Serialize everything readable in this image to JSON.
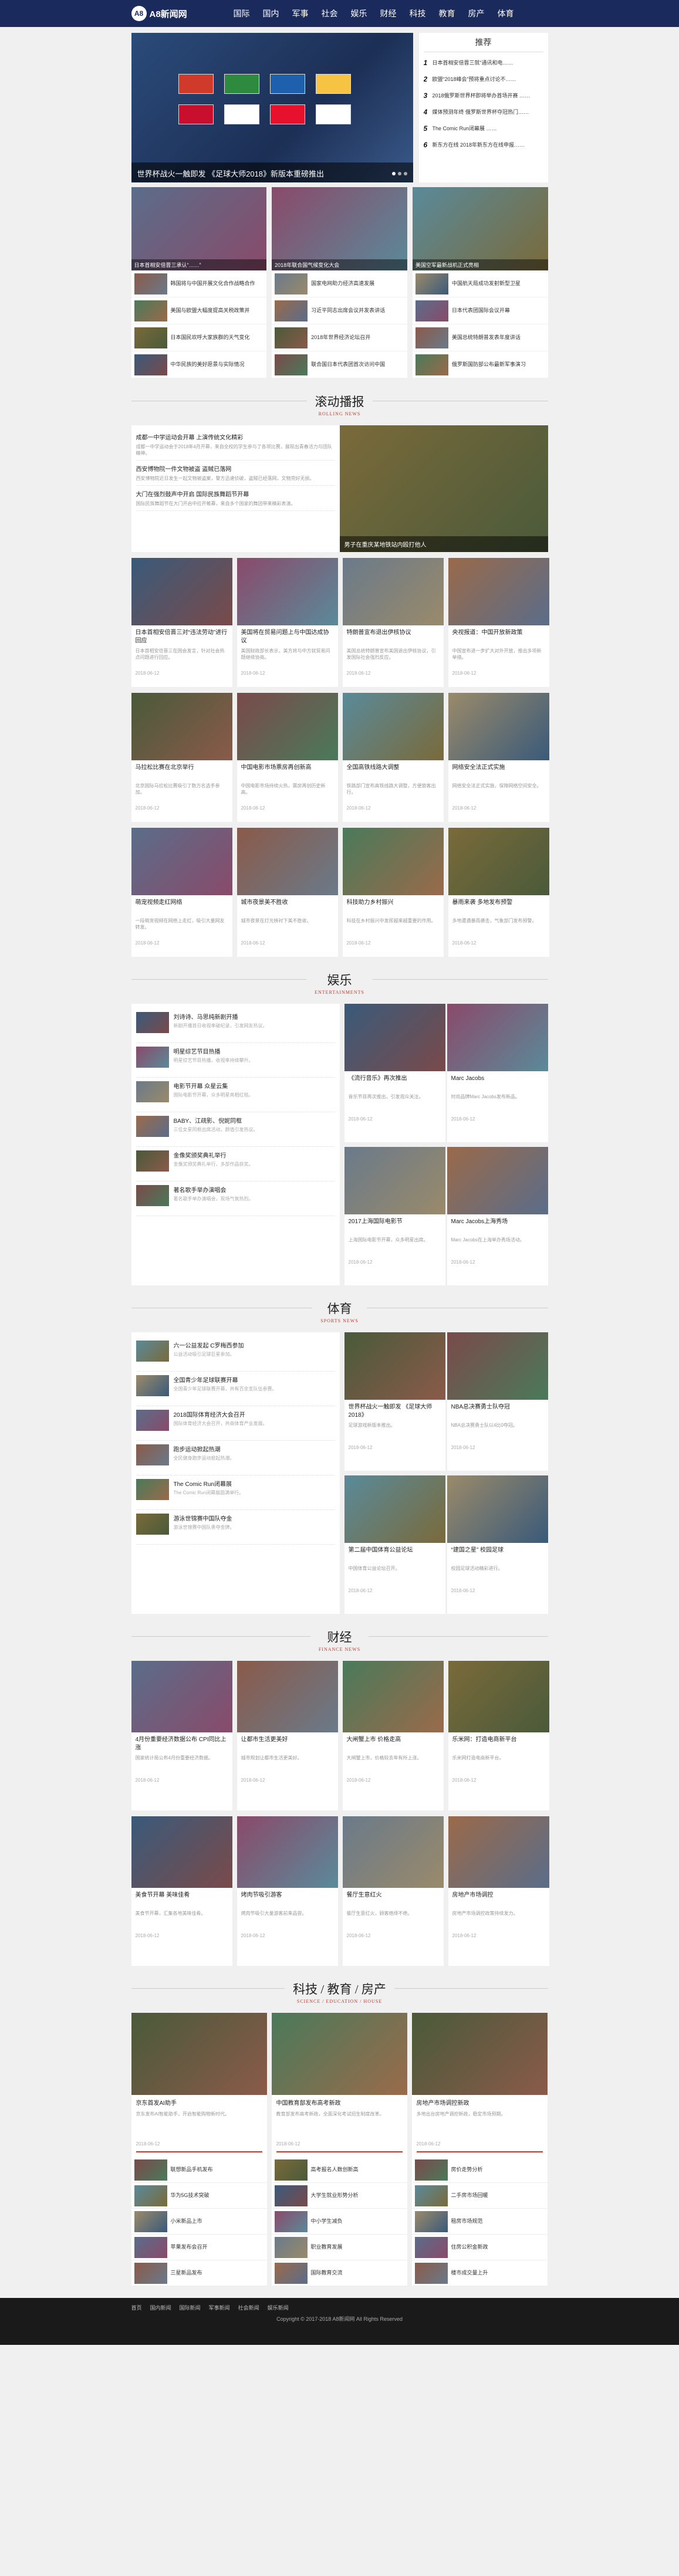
{
  "header": {
    "logo": "A8新闻网",
    "logo_mark": "A8",
    "nav": [
      "国际",
      "国内",
      "军事",
      "社会",
      "娱乐",
      "财经",
      "科技",
      "教育",
      "房产",
      "体育"
    ]
  },
  "hero": {
    "caption": "世界杯战火一触即发 《足球大师2018》新版本重磅推出",
    "colors": [
      "#d03a2b",
      "#2d8a3e",
      "#1e5fae",
      "#f6c343",
      "#c8102e",
      "#ffffff",
      "#e8112d",
      "#ffffff"
    ]
  },
  "recommend": {
    "title": "推荐",
    "items": [
      "日本首相安倍晋三就“通讯和电……",
      "欧盟“2018峰会”预将重点讨论不……",
      "2018俄罗斯世界杯即将举办首场开赛 ……",
      "媒体预测年终 俄罗斯世界杯夺冠热门……",
      "The Comic Run闭幕展 ……",
      "新东方在线 2018年新东方在线申报……"
    ]
  },
  "top_cols": [
    {
      "caption": "日本首相安倍晋三承认“……”",
      "items": [
        "韩国将与中国开展文化合作战略合作",
        "美国与欧盟大幅度提高关税政策并",
        "日本国民欢呼大家族群的天气变化",
        "中华民族的美好愿景与实际情况"
      ]
    },
    {
      "caption": "2018年联合国气候变化大会",
      "items": [
        "国家电网助力经济高速发展",
        "习近平同志出席会议并发表讲话",
        "2018年世界经济论坛召开",
        "联合国日本代表团首次访问中国"
      ]
    },
    {
      "caption": "美国空军最新战机正式亮相",
      "items": [
        "中国航天局成功发射新型卫星",
        "日本代表团国际会议开幕",
        "美国总统特朗普发表年度讲话",
        "俄罗斯国防部公布最新军事演习"
      ]
    }
  ],
  "section_rolling": {
    "title": "滚动播报",
    "sub": "ROLLING NEWS"
  },
  "rolling": {
    "items": [
      {
        "title": "成都一中学运动会开幕 上演传统文化精彩",
        "desc": "成都一中学运动会于2018年4月开幕，来自全校的学生参与了各项比赛，展现出青春活力与团队精神。"
      },
      {
        "title": "西安博物院一件文物被盗 盗贼已落网",
        "desc": "西安博物院近日发生一起文物被盗案，警方迅速侦破，盗贼已经落网，文物完好无损。"
      },
      {
        "title": "大门在强烈鼓声中开启 国际民族舞蹈节开幕",
        "desc": "国际民族舞蹈节在大门开启中拉开帷幕，来自多个国家的舞团带来精彩表演。"
      }
    ],
    "image_caption": "男子在重庆某地铁站内殴打他人"
  },
  "cards_row1": [
    {
      "title": "日本首相安倍晋三对“违法劳动”进行回应",
      "desc": "日本首相安倍晋三在国会发言，针对社会热点问题进行回应。",
      "date": "2018-06-12"
    },
    {
      "title": "美国将在贸易问题上与中国达成协议",
      "desc": "美国财政部长表示，美方将与中方就贸易问题继续协商。",
      "date": "2018-06-12"
    },
    {
      "title": "特朗普宣布退出伊核协议",
      "desc": "美国总统特朗普宣布美国退出伊核协议，引发国际社会强烈反应。",
      "date": "2018-06-12"
    },
    {
      "title": "央视报道：中国开放新政策",
      "desc": "中国宣布进一步扩大对外开放，推出多项新举措。",
      "date": "2018-06-12"
    }
  ],
  "cards_row2": [
    {
      "title": "马拉松比赛在北京举行",
      "desc": "北京国际马拉松比赛吸引了数万名选手参加。",
      "date": "2018-06-12"
    },
    {
      "title": "中国电影市场票房再创新高",
      "desc": "中国电影市场持续火热，票房再创历史新高。",
      "date": "2018-06-12"
    },
    {
      "title": "全国高铁线路大调整",
      "desc": "铁路部门宣布高铁线路大调整，方便旅客出行。",
      "date": "2018-06-12"
    },
    {
      "title": "网络安全法正式实施",
      "desc": "网络安全法正式实施，保障网络空间安全。",
      "date": "2018-06-12"
    }
  ],
  "cards_row3": [
    {
      "title": "萌宠视频走红网络",
      "desc": "一段萌宠视频在网络上走红，吸引大量网友转发。",
      "date": "2018-06-12"
    },
    {
      "title": "城市夜景美不胜收",
      "desc": "城市夜景在灯光映衬下美不胜收。",
      "date": "2018-06-12"
    },
    {
      "title": "科技助力乡村振兴",
      "desc": "科技在乡村振兴中发挥越来越重要的作用。",
      "date": "2018-06-12"
    },
    {
      "title": "暴雨来袭 多地发布预警",
      "desc": "多地遭遇暴雨袭击，气象部门发布预警。",
      "date": "2018-06-12"
    }
  ],
  "section_ent": {
    "title": "娱乐",
    "sub": "ENTERTAINMENTS"
  },
  "ent": {
    "list": [
      {
        "title": "刘诗诗、马思纯新剧开播",
        "desc": "新剧开播首日收视率破纪录，引发网友热议。"
      },
      {
        "title": "明星综艺节目热播",
        "desc": "明星综艺节目热播，收视率持续攀升。"
      },
      {
        "title": "电影节开幕 众星云集",
        "desc": "国际电影节开幕，众多明星亮相红毯。"
      },
      {
        "title": "BABY、江疏影、倪妮同框",
        "desc": "三位女星同框出席活动，颜值引发热议。"
      },
      {
        "title": "金像奖颁奖典礼举行",
        "desc": "金像奖颁奖典礼举行，多部作品获奖。"
      },
      {
        "title": "著名歌手举办演唱会",
        "desc": "著名歌手举办演唱会，现场气氛热烈。"
      }
    ],
    "cards": [
      {
        "title": "《流行音乐》再次推出",
        "desc": "音乐节目再次推出，引发观众关注。",
        "date": "2018-06-12"
      },
      {
        "title": "Marc Jacobs",
        "desc": "时尚品牌Marc Jacobs发布新品。",
        "date": "2018-06-12"
      },
      {
        "title": "2017上海国际电影节",
        "desc": "上海国际电影节开幕，众多明星出席。",
        "date": "2018-06-12"
      },
      {
        "title": "Marc Jacobs上海秀场",
        "desc": "Marc Jacobs在上海举办秀场活动。",
        "date": "2018-06-12"
      }
    ]
  },
  "section_sports": {
    "title": "体育",
    "sub": "SPORTS NEWS"
  },
  "sports": {
    "list": [
      {
        "title": "六一公益发起 C罗梅西参加",
        "desc": "公益活动吸引足球巨星参加。"
      },
      {
        "title": "全国青少年足球联赛开幕",
        "desc": "全国青少年足球联赛开幕，共有百余支队伍参赛。"
      },
      {
        "title": "2018国际体育经济大会召开",
        "desc": "国际体育经济大会召开，共商体育产业发展。"
      },
      {
        "title": "跑步运动掀起热潮",
        "desc": "全民健身跑步运动掀起热潮。"
      },
      {
        "title": "The Comic Run闭幕展",
        "desc": "The Comic Run闭幕展圆满举行。"
      },
      {
        "title": "游泳世锦赛中国队夺金",
        "desc": "游泳世锦赛中国队勇夺金牌。"
      }
    ],
    "cards": [
      {
        "title": "世界杯战火一触即发 《足球大师2018》",
        "desc": "足球游戏新版本推出。",
        "date": "2018-06-12"
      },
      {
        "title": "NBA总决赛勇士队夺冠",
        "desc": "NBA总决赛勇士队以4比0夺冠。",
        "date": "2018-06-12"
      },
      {
        "title": "第二届中国体育公益论坛",
        "desc": "中国体育公益论坛召开。",
        "date": "2018-06-12"
      },
      {
        "title": "“建国之星” 校园足球",
        "desc": "校园足球活动精彩进行。",
        "date": "2018-06-12"
      }
    ]
  },
  "section_fin": {
    "title": "财经",
    "sub": "FINANCE NEWS"
  },
  "fin_row1": [
    {
      "title": "4月份重要经济数据公布 CPI同比上涨",
      "desc": "国家统计局公布4月份重要经济数据。",
      "date": "2018-06-12"
    },
    {
      "title": "让都市生活更美好",
      "desc": "城市规划让都市生活更美好。",
      "date": "2018-06-12"
    },
    {
      "title": "大闸蟹上市 价格走高",
      "desc": "大闸蟹上市，价格较去年有所上涨。",
      "date": "2018-06-12"
    },
    {
      "title": "乐米网：打造电商新平台",
      "desc": "乐米网打造电商新平台。",
      "date": "2018-06-12"
    }
  ],
  "fin_row2": [
    {
      "title": "美食节开幕 美味佳肴",
      "desc": "美食节开幕，汇集各地美味佳肴。",
      "date": "2018-06-12"
    },
    {
      "title": "烤肉节吸引游客",
      "desc": "烤肉节吸引大量游客前来品尝。",
      "date": "2018-06-12"
    },
    {
      "title": "餐厅生意红火",
      "desc": "餐厅生意红火，顾客络绎不绝。",
      "date": "2018-06-12"
    },
    {
      "title": "房地产市场调控",
      "desc": "房地产市场调控政策持续发力。",
      "date": "2018-06-12"
    }
  ],
  "section_tech": {
    "title": "科技 / 教育 / 房产",
    "sub": "SCIENCE / EDUCATION / HOUSE"
  },
  "tech": [
    {
      "title": "京东首发AI助手",
      "desc": "京东发布AI智能助手，开启智能购物新时代。",
      "date": "2018-06-12",
      "list": [
        "联想新品手机发布",
        "华为5G技术突破",
        "小米新品上市",
        "苹果发布会召开",
        "三星新品发布"
      ]
    },
    {
      "title": "中国教育部发布高考新政",
      "desc": "教育部发布高考新政，全面深化考试招生制度改革。",
      "date": "2018-06-12",
      "list": [
        "高考报名人数创新高",
        "大学生就业形势分析",
        "中小学生减负",
        "职业教育发展",
        "国际教育交流"
      ]
    },
    {
      "title": "房地产市场调控新政",
      "desc": "多地出台房地产调控新政，稳定市场预期。",
      "date": "2018-06-12",
      "list": [
        "房价走势分析",
        "二手房市场回暖",
        "租房市场规范",
        "住房公积金新政",
        "楼市成交量上升"
      ]
    }
  ],
  "footer": {
    "links": [
      "首页",
      "国内新闻",
      "国际新闻",
      "军事新闻",
      "社会新闻",
      "娱乐新闻"
    ],
    "copy": "Copyright © 2017-2018 A8新闻网 All Rights Reserved"
  }
}
